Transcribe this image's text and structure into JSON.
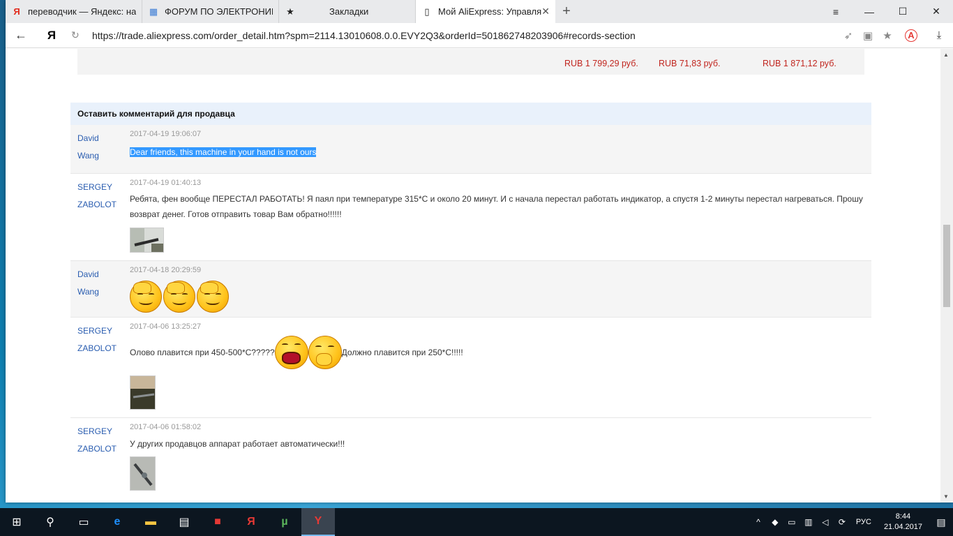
{
  "tabs": [
    {
      "title": "переводчик — Яндекс: наш",
      "icon": "Я",
      "icon_color": "#e22b1c"
    },
    {
      "title": "ФОРУМ ПО ЭЛЕКТРОНИКЕ",
      "icon": "▦",
      "icon_color": "#3a7bd5"
    },
    {
      "title": "Закладки",
      "icon": "★",
      "icon_color": "#333333"
    },
    {
      "title": "Мой AliExpress: Управля",
      "icon": "▯",
      "icon_color": "#555555",
      "active": true
    }
  ],
  "address_bar": {
    "url": "https://trade.aliexpress.com/order_detail.htm?spm=2114.13010608.0.0.EVY2Q3&orderId=501862748203906#records-section",
    "yandex_label": "Я"
  },
  "totals": {
    "product_price": "RUB 1 799,29 руб.",
    "shipping": "RUB 71,83 руб.",
    "total": "RUB 1 871,12 руб."
  },
  "comments_section": {
    "title": "Оставить комментарий для продавца",
    "messages": [
      {
        "author": "David Wang",
        "date": "2017-04-19 19:06:07",
        "text": "Dear friends, this machine in your hand is not ours",
        "highlighted": true
      },
      {
        "author": "SERGEY ZABOLOT",
        "date": "2017-04-19 01:40:13",
        "text": "Ребята, фен вообще ПЕРЕСТАЛ РАБОТАТЬ! Я паял при температуре 315*С и около 20 минут. И с начала перестал работать индикатор, а спустя 1-2 минуты перестал нагреваться. Прошу возврат денег. Готов отправить товар Вам обратно!!!!!!"
      },
      {
        "author": "David Wang",
        "date": "2017-04-18 20:29:59",
        "text": ""
      },
      {
        "author": "SERGEY ZABOLOT",
        "date": "2017-04-06 13:25:27",
        "text_before": "Олово плавится при 450-500*С?????",
        "text_after": "Должно плавится при 250*С!!!!!"
      },
      {
        "author": "SERGEY ZABOLOT",
        "date": "2017-04-06 01:58:02",
        "text": "У других продавцов аппарат работает автоматически!!!"
      }
    ]
  },
  "taskbar": {
    "language": "РУС",
    "time": "8:44",
    "date": "21.04.2017"
  }
}
